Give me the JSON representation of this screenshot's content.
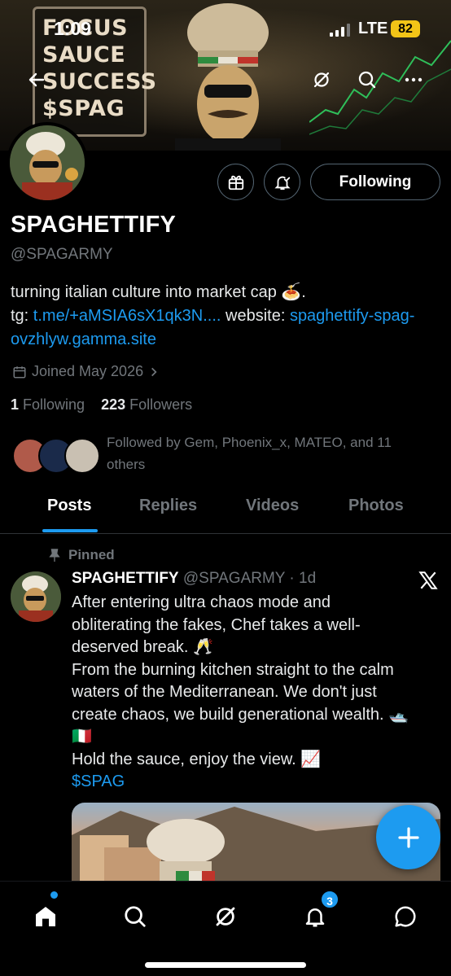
{
  "status_bar": {
    "time": "1:09",
    "network": "LTE",
    "battery": "82"
  },
  "banner": {
    "sign_lines": [
      "FOCUS",
      "SAUCE",
      "SUCCESS",
      "$SPAG"
    ]
  },
  "profile": {
    "display_name": "SPAGHETTIFY",
    "handle": "@SPAGARMY",
    "follow_button": "Following",
    "bio_line1": "turning italian culture into market cap 🍝.",
    "bio_tg_label": " tg: ",
    "bio_tg_link": "t.me/+aMSIA6sX1qk3N....",
    "bio_website_label": " website: ",
    "bio_website_link": "spaghettify-spag-ovzhlyw.gamma.site",
    "joined": "Joined May 2026",
    "following_count": "1",
    "following_label": "Following",
    "followers_count": "223",
    "followers_label": "Followers",
    "followed_by": "Followed by Gem, Phoenix_x, MATEO, and 11 others"
  },
  "tabs": [
    "Posts",
    "Replies",
    "Videos",
    "Photos"
  ],
  "post": {
    "pinned_label": "Pinned",
    "author": "SPAGHETTIFY",
    "handle_time": "@SPAGARMY · 1d",
    "lines": [
      "After entering ultra chaos mode and",
      "obliterating the fakes, Chef takes a well-",
      "deserved break. 🥂",
      "From the burning kitchen straight to the calm",
      "waters of the Mediterranean. We don't just",
      "create chaos, we build generational wealth. 🛥️",
      "🇮🇹",
      "Hold the sauce, enjoy the view. 📈"
    ],
    "cashtag": "$SPAG"
  },
  "nav": {
    "notifications_badge": "3"
  },
  "colors": {
    "accent": "#1d9bf0",
    "background": "#000000",
    "muted": "#71767b"
  }
}
